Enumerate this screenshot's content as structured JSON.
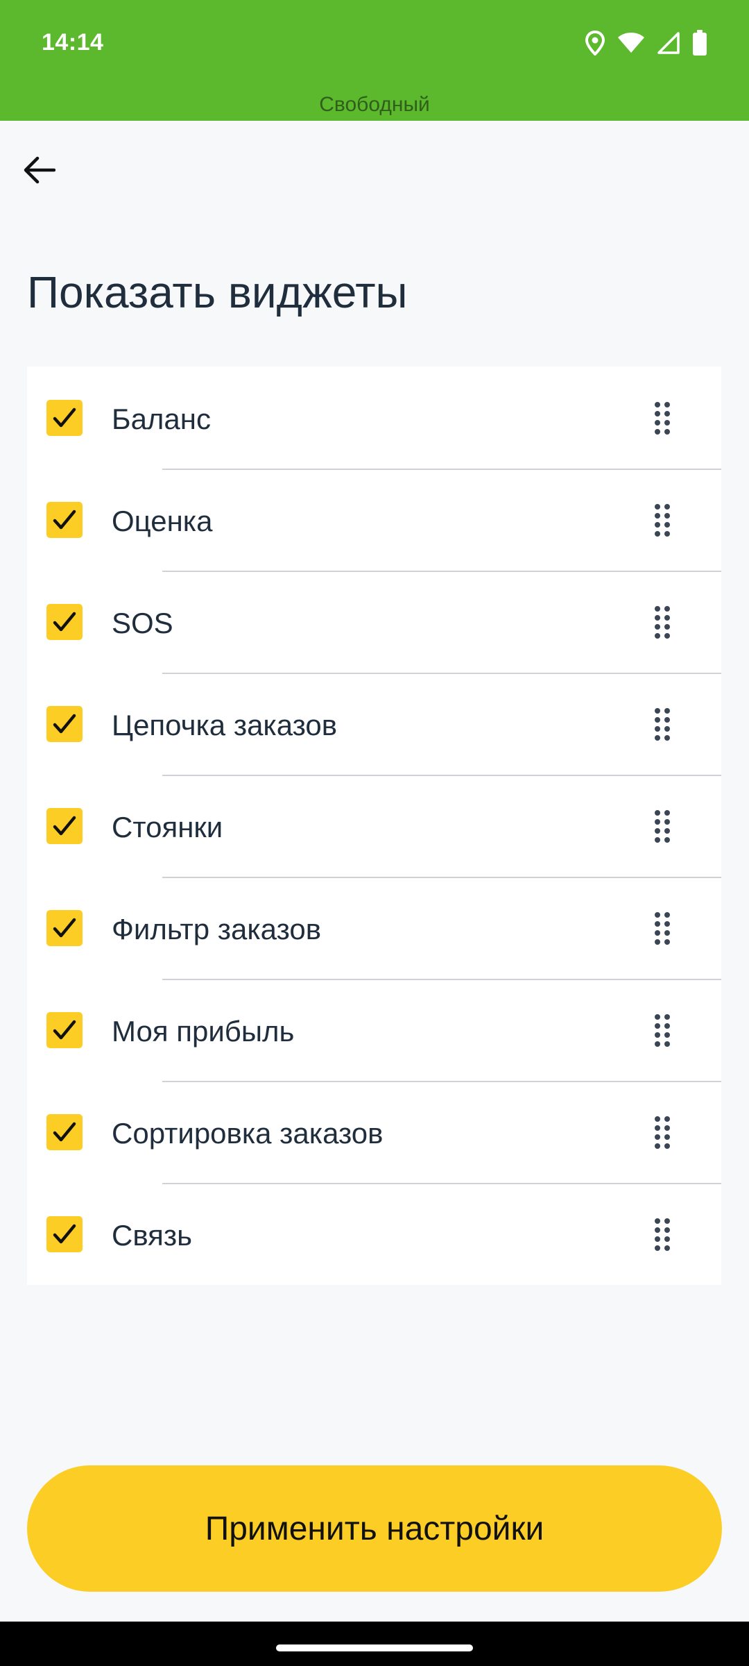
{
  "status_bar": {
    "time": "14:14",
    "caption": "Свободный",
    "icons": [
      "location-icon",
      "wifi-icon",
      "cellular-signal-icon",
      "battery-icon"
    ]
  },
  "header": {
    "back_icon": "arrow-left-icon",
    "title": "Показать виджеты"
  },
  "widgets": [
    {
      "label": "Баланс",
      "checked": true
    },
    {
      "label": "Оценка",
      "checked": true
    },
    {
      "label": "SOS",
      "checked": true
    },
    {
      "label": "Цепочка заказов",
      "checked": true
    },
    {
      "label": "Стоянки",
      "checked": true
    },
    {
      "label": "Фильтр заказов",
      "checked": true
    },
    {
      "label": "Моя прибыль",
      "checked": true
    },
    {
      "label": "Сортировка заказов",
      "checked": true
    },
    {
      "label": "Связь",
      "checked": true
    }
  ],
  "apply_button": {
    "label": "Применить настройки"
  },
  "colors": {
    "status_bar": "#5cb82d",
    "accent": "#fccd24",
    "text": "#1f2d3d",
    "background": "#f7f8fa"
  }
}
